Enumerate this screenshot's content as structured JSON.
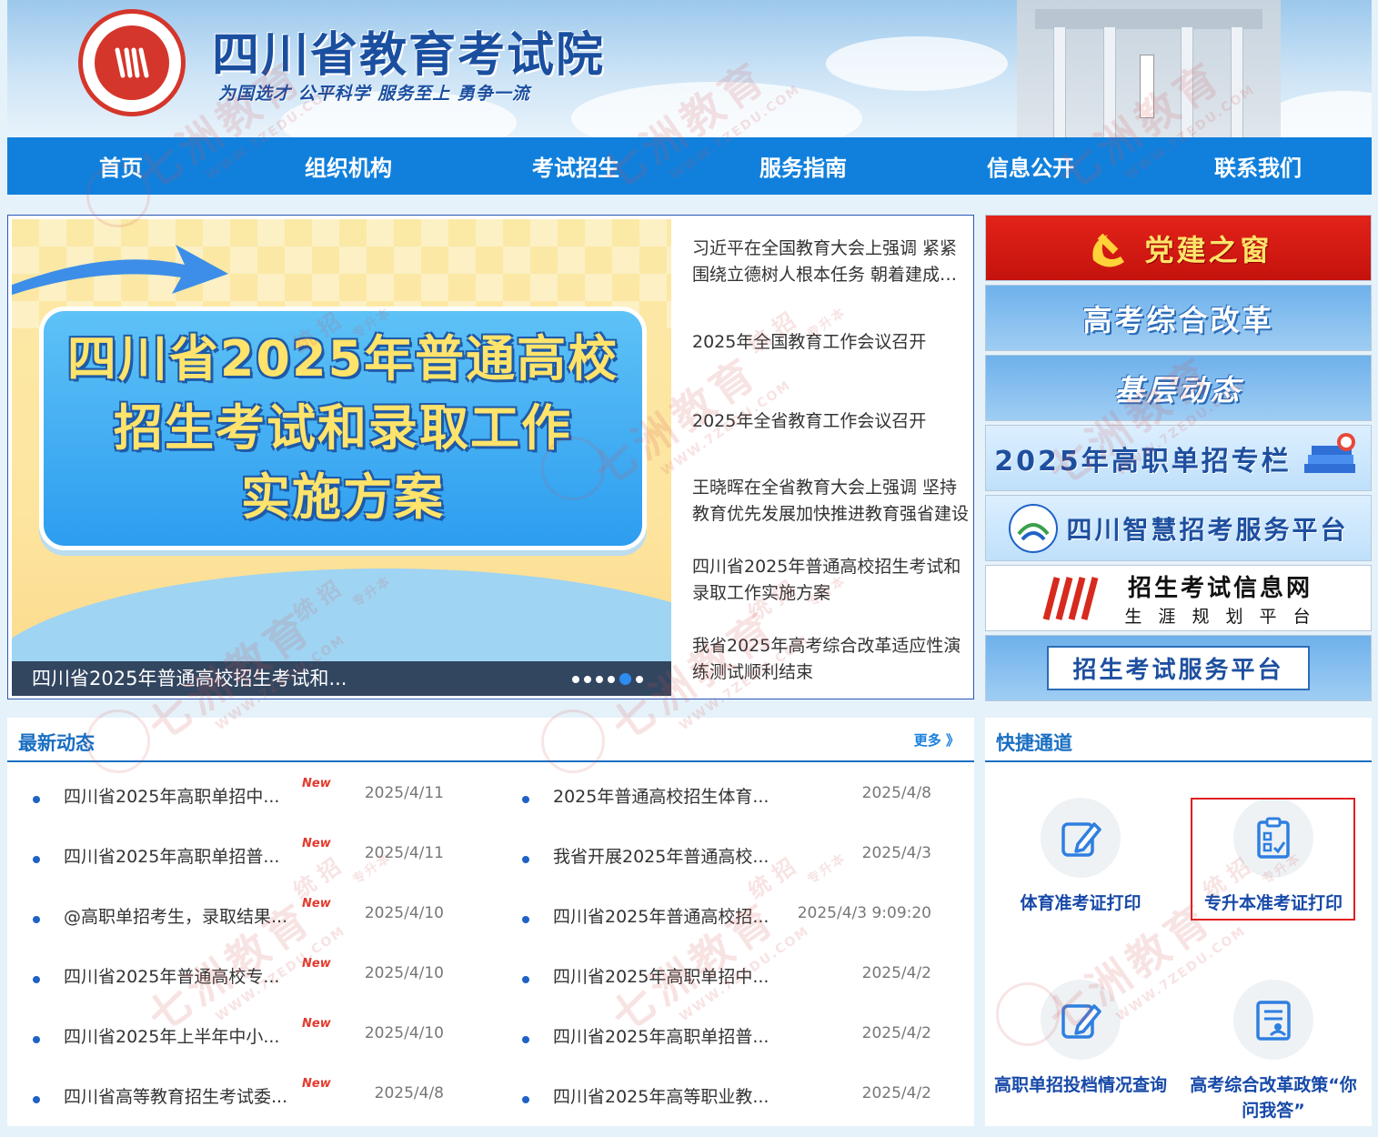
{
  "header": {
    "title": "四川省教育考试院",
    "slogan": "为国选才 公平科学 服务至上 勇争一流"
  },
  "nav": {
    "items": [
      "首页",
      "组织机构",
      "考试招生",
      "服务指南",
      "信息公开",
      "联系我们"
    ]
  },
  "slider": {
    "slide_lines": [
      "四川省2025年普通高校",
      "招生考试和录取工作",
      "实施方案"
    ],
    "caption": "四川省2025年普通高校招生考试和...",
    "dot_count": 6,
    "active_dot": 4
  },
  "headlines": [
    "习近平在全国教育大会上强调 紧紧围绕立德树人根本任务 朝着建成教育强国战略目标扎实迈进",
    "2025年全国教育工作会议召开",
    "2025年全省教育工作会议召开",
    "王晓晖在全省教育大会上强调 坚持教育优先发展加快推进教育强省建设",
    "四川省2025年普通高校招生考试和录取工作实施方案",
    "我省2025年高考综合改革适应性演练测试顺利结束"
  ],
  "banners": [
    "党建之窗",
    "高考综合改革",
    "基层动态",
    "2025年高职单招专栏",
    "四川智慧招考服务平台",
    "招生考试信息网",
    "招生考试服务平台"
  ],
  "banner_sub": "生 涯 规 划 平 台",
  "news": {
    "title": "最新动态",
    "more": "更多 》",
    "new_tag": "New",
    "left": [
      {
        "title": "四川省2025年高职单招中...",
        "date": "2025/4/11"
      },
      {
        "title": "四川省2025年高职单招普...",
        "date": "2025/4/11"
      },
      {
        "title": "@高职单招考生，录取结果...",
        "date": "2025/4/10"
      },
      {
        "title": "四川省2025年普通高校专...",
        "date": "2025/4/10"
      },
      {
        "title": "四川省2025年上半年中小...",
        "date": "2025/4/10"
      },
      {
        "title": "四川省高等教育招生考试委...",
        "date": "2025/4/8"
      }
    ],
    "right": [
      {
        "title": "2025年普通高校招生体育...",
        "date": "2025/4/8"
      },
      {
        "title": "我省开展2025年普通高校...",
        "date": "2025/4/3"
      },
      {
        "title": "四川省2025年普通高校招...",
        "date": "2025/4/3 9:09:20"
      },
      {
        "title": "四川省2025年高职单招中...",
        "date": "2025/4/2"
      },
      {
        "title": "四川省2025年高职单招普...",
        "date": "2025/4/2"
      },
      {
        "title": "四川省2025年高等职业教...",
        "date": "2025/4/2"
      }
    ]
  },
  "quick": {
    "title": "快捷通道",
    "items": [
      "体育准考证打印",
      "专升本准考证打印",
      "高职单招投档情况查询",
      "高考综合改革政策“你问我答”"
    ]
  },
  "watermark": {
    "brand": "七洲教育",
    "url": "WWW.7ZEDU.COM",
    "tag1": "统 招",
    "tag2": "专升本"
  },
  "colors": {
    "nav_bg": "#1180dc",
    "accent": "#1a6fc2",
    "new_tag": "#e23b2e",
    "highlight": "#e02020"
  }
}
